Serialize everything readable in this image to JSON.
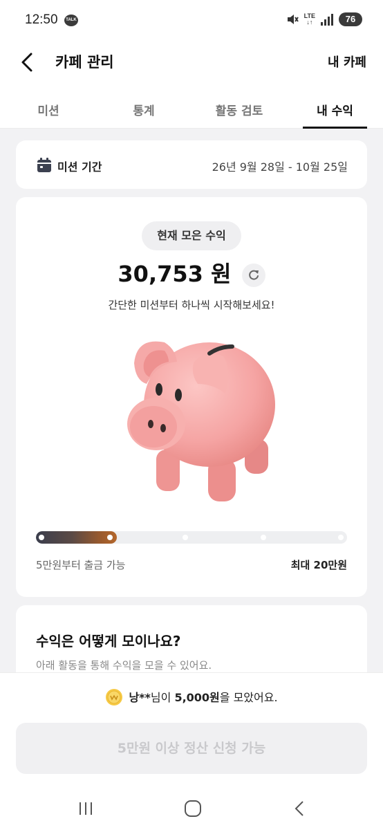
{
  "status": {
    "time": "12:50",
    "talk_badge": "TALK",
    "network": "LTE",
    "battery": "76"
  },
  "header": {
    "title": "카페 관리",
    "right_link": "내 카페"
  },
  "tabs": [
    {
      "label": "미션"
    },
    {
      "label": "통계"
    },
    {
      "label": "활동 검토"
    },
    {
      "label": "내 수익",
      "active": true
    }
  ],
  "period": {
    "label": "미션 기간",
    "value": "26년 9월 28일 - 10월 25일"
  },
  "earnings": {
    "pill": "현재 모은 수익",
    "amount": "30,753 원",
    "subtitle": "간단한 미션부터 하나씩 시작해보세요!",
    "progress_fraction": 0.26,
    "progress_left_label": "5만원부터 출금 가능",
    "progress_right_label": "최대 20만원"
  },
  "howto": {
    "title": "수익은 어떻게 모이나요?",
    "subtitle": "아래 활동을 통해 수익을 모을 수 있어요."
  },
  "ticker": {
    "name": "낭**",
    "mid": "님이 ",
    "amount": "5,000원",
    "suffix": "을 모았어요."
  },
  "cta": {
    "label": "5만원 이상 정산 신청 가능"
  },
  "colors": {
    "accent": "#111111",
    "progress_start": "#3b3e4d",
    "progress_end": "#b4672c",
    "cta_bg": "#f0f0f2",
    "pig": "#f4a4a4"
  },
  "icons": [
    "back-icon",
    "calendar-icon",
    "refresh-icon",
    "piggy-bank-image",
    "coin-icon",
    "recents-icon",
    "home-icon",
    "nav-back-icon"
  ]
}
